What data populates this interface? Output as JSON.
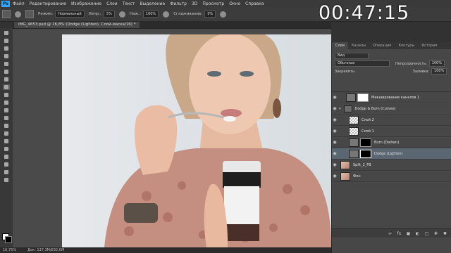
{
  "menubar": {
    "logo": "Ps",
    "items": [
      "Файл",
      "Редактирование",
      "Изображение",
      "Слои",
      "Текст",
      "Выделение",
      "Фильтр",
      "3D",
      "Просмотр",
      "Окно",
      "Справка"
    ]
  },
  "options": {
    "mode_label": "Режим:",
    "mode_value": "Нормальный",
    "opacity_label": "Непр.:",
    "opacity_value": "5%",
    "flow_label": "Наж.:",
    "flow_value": "100%",
    "smoothing_label": "Сглаживание:",
    "smoothing_value": "0%"
  },
  "timer": "00:47:15",
  "document": {
    "tab_title": "IMG_4653.psd @ 16,8% (Dodge (Lighten), Слой-маска/16) *"
  },
  "status": {
    "zoom": "16,75%",
    "doc_size": "Док: 137,3M/832,6M"
  },
  "panel": {
    "tabs": [
      "Слои",
      "Каналы",
      "Операции",
      "Контуры",
      "История"
    ],
    "active_tab": "Слои",
    "filter_kind": "Вид",
    "blend_mode": "Обычные",
    "opacity_label": "Непрозрачность:",
    "opacity_value": "100%",
    "lock_label": "Закрепить:",
    "fill_label": "Заливка:",
    "fill_value": "100%",
    "layers": [
      {
        "name": "Микширование каналов 1",
        "thumb": "adjust",
        "mask": "white"
      },
      {
        "name": "Dodge & Burn (Curves)",
        "thumb": "folder"
      },
      {
        "name": "Слой 2",
        "thumb": "checker"
      },
      {
        "name": "Слой 1",
        "thumb": "checker"
      },
      {
        "name": "Burn (Darken)",
        "thumb": "adjust",
        "mask": "black"
      },
      {
        "name": "Dodge (Lighten)",
        "thumb": "adjust",
        "mask": "black"
      },
      {
        "name": "Split_2_FB",
        "thumb": "photo"
      },
      {
        "name": "Фон",
        "thumb": "photo"
      }
    ]
  }
}
